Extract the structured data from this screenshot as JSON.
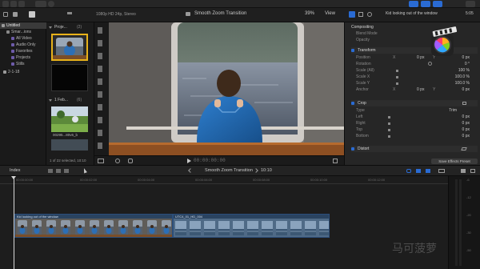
{
  "toolbar": {
    "viewer_format": "1080p HD 24p, Stereo",
    "project_title": "Smooth Zoom Transition",
    "zoom": "39%",
    "view_label": "View",
    "inspector_clip_title": "Kid looking out of the window",
    "inspector_duration": "5:05"
  },
  "sidebar": {
    "items": [
      {
        "label": "Untitled",
        "level": 0,
        "selected": true
      },
      {
        "label": "Smar...ions",
        "level": 1
      },
      {
        "label": "All Video",
        "level": 2
      },
      {
        "label": "Audio Only",
        "level": 2
      },
      {
        "label": "Favorites",
        "level": 2
      },
      {
        "label": "Projects",
        "level": 2
      },
      {
        "label": "Stills",
        "level": 2
      },
      {
        "label": "2-1-18",
        "level": 1
      }
    ]
  },
  "browser": {
    "group1_label": "Proje...",
    "group1_count": "(2)",
    "group2_label": "1 Feb...",
    "group2_count": "(6)",
    "thumb_caption": "00295...80v6_b",
    "selection_status": "1 of 22 selected, 10:10"
  },
  "viewer": {
    "timecode": "00:00:00:00"
  },
  "inspector": {
    "compositing_label": "Compositing",
    "blend_mode_label": "Blend Mode",
    "opacity_label": "Opacity",
    "transform_label": "Transform",
    "position_label": "Position",
    "position_x_axis": "X",
    "position_x": "0 px",
    "position_y_axis": "Y",
    "position_y": "0 px",
    "rotation_label": "Rotation",
    "rotation_value": "0 °",
    "scale_all_label": "Scale (All)",
    "scale_all_value": "100 %",
    "scale_x_label": "Scale X",
    "scale_x_value": "100.0 %",
    "scale_y_label": "Scale Y",
    "scale_y_value": "100.0 %",
    "anchor_label": "Anchor",
    "anchor_x_axis": "X",
    "anchor_x": "0 px",
    "anchor_y_axis": "Y",
    "anchor_y": "0 px",
    "crop_label": "Crop",
    "type_label": "Type",
    "type_value": "Trim",
    "left_label": "Left",
    "left_value": "0 px",
    "right_label": "Right",
    "right_value": "0 px",
    "top_label": "Top",
    "top_value": "0 px",
    "bottom_label": "Bottom",
    "bottom_value": "0 px",
    "distort_label": "Distort",
    "save_preset": "Save Effects Preset"
  },
  "timeline": {
    "index_label": "Index",
    "project_title": "Smooth Zoom Transition",
    "duration": "10:10",
    "ruler": [
      "00:00:00:00",
      "00:00:02:00",
      "00:00:04:00",
      "00:00:06:00",
      "00:00:08:00",
      "00:00:10:00",
      "00:00:12:00"
    ],
    "clip1_title": "Kid looking out of the window",
    "clip2_title": "UTC4_01_HD_004",
    "meter_labels": [
      "-6",
      "-12",
      "-20",
      "-30",
      "-50"
    ]
  },
  "colors": {
    "accent_blue": "#2a6bd3",
    "clip_blue": "#2a4360",
    "background": "#1b1b1b"
  },
  "watermark": "马可菠萝"
}
